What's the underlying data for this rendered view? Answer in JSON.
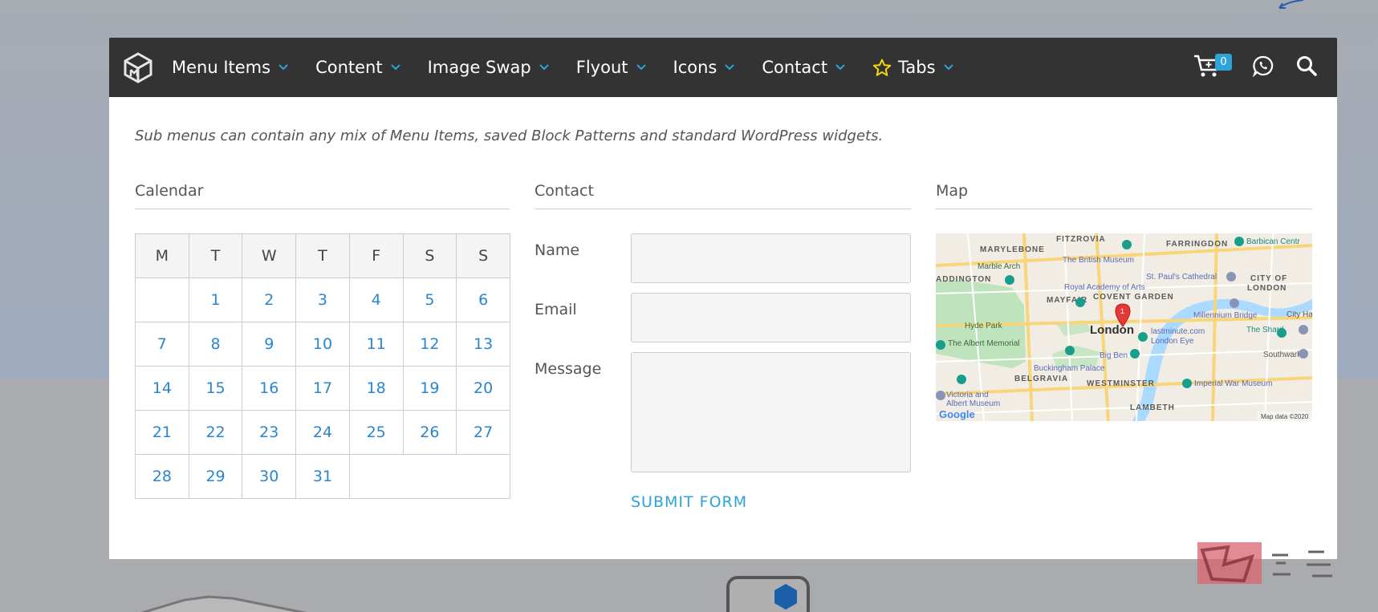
{
  "navbar": {
    "items": [
      {
        "label": "Menu Items"
      },
      {
        "label": "Content"
      },
      {
        "label": "Image Swap"
      },
      {
        "label": "Flyout"
      },
      {
        "label": "Icons"
      },
      {
        "label": "Contact"
      },
      {
        "label": "Tabs",
        "icon": "star-icon"
      }
    ],
    "cart_count": "0",
    "accent_color": "#2ea3d9",
    "star_color": "#f5d90a"
  },
  "panel": {
    "intro": "Sub menus can contain any mix of Menu Items, saved Block Patterns and standard WordPress widgets.",
    "calendar": {
      "title": "Calendar",
      "days": [
        "M",
        "T",
        "W",
        "T",
        "F",
        "S",
        "S"
      ],
      "weeks": [
        [
          "",
          "1",
          "2",
          "3",
          "4",
          "5",
          "6"
        ],
        [
          "7",
          "8",
          "9",
          "10",
          "11",
          "12",
          "13"
        ],
        [
          "14",
          "15",
          "16",
          "17",
          "18",
          "19",
          "20"
        ],
        [
          "21",
          "22",
          "23",
          "24",
          "25",
          "26",
          "27"
        ],
        [
          "28",
          "29",
          "30",
          "31",
          "",
          "",
          ""
        ]
      ]
    },
    "contact": {
      "title": "Contact",
      "name_label": "Name",
      "email_label": "Email",
      "message_label": "Message",
      "submit_label": "SUBMIT FORM"
    },
    "map": {
      "title": "Map",
      "labels": {
        "fitzrovia": "FITZROVIA",
        "marylebone": "MARYLEBONE",
        "farringdon": "FARRINGDON",
        "barbican": "Barbican Centr",
        "british_museum": "The British Museum",
        "marble_arch": "Marble Arch",
        "paddington": "ADDINGTON",
        "st_pauls": "St. Paul's Cathedral",
        "city_of": "CITY OF",
        "london_city": "LONDON",
        "royal_academy": "Royal Academy of Arts",
        "mayfair": "MAYFAIR",
        "covent_garden": "COVENT GARDEN",
        "millennium_bridge": "Millennium Bridge",
        "city_hall": "City Ha",
        "hyde_park": "Hyde Park",
        "london": "London",
        "lastminute": "lastminute.com",
        "london_eye": "London Eye",
        "the_shard": "The Shard",
        "albert_memorial": "The Albert Memorial",
        "big_ben": "Big Ben",
        "southwark": "Southwark",
        "buckingham": "Buckingham Palace",
        "belgravia": "BELGRAVIA",
        "westminster": "WESTMINSTER",
        "imperial_war": "Imperial War Museum",
        "victoria_albert_1": "Victoria and",
        "victoria_albert_2": "Albert Museum",
        "lambeth": "LAMBETH",
        "google": "Google",
        "map_data": "Map data ©2020",
        "marker_number": "1"
      }
    }
  }
}
